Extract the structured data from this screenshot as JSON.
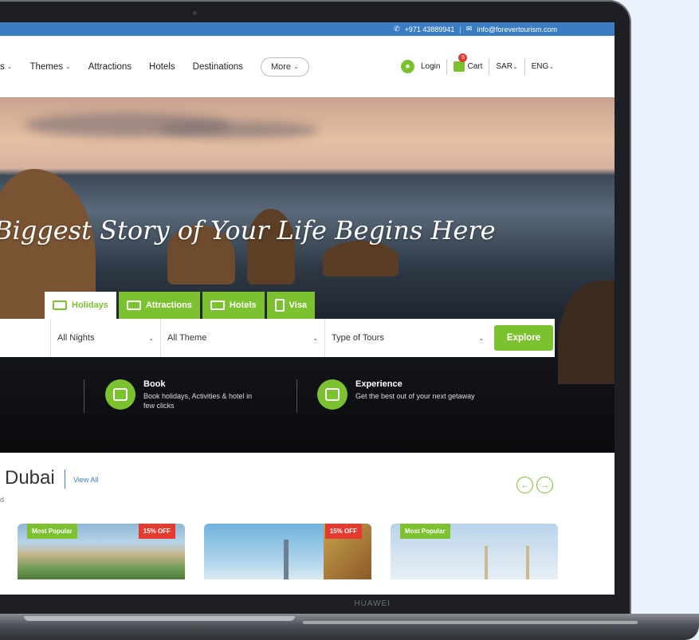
{
  "topbar": {
    "phone": "+971 43889941",
    "separator": "|",
    "email": "info@forevertourism.com"
  },
  "nav": {
    "items": [
      {
        "label": "s"
      },
      {
        "label": "Themes"
      },
      {
        "label": "Attractions"
      },
      {
        "label": "Hotels"
      },
      {
        "label": "Destinations"
      }
    ],
    "more": "More",
    "login": "Login",
    "cart": "Cart",
    "cart_count": "5",
    "currency": "SAR",
    "language": "ENG"
  },
  "hero": {
    "headline": "Biggest Story of Your Life Begins Here",
    "tabs": [
      "Holidays",
      "Attractions",
      "Hotels",
      "Visa"
    ],
    "search": {
      "nights": "All Nights",
      "theme": "All Theme",
      "tour_type": "Type of Tours",
      "explore": "Explore"
    },
    "features": [
      {
        "title": "Book",
        "desc": "Book holidays, Activities & hotel in few clicks"
      },
      {
        "title": "Experience",
        "desc": "Get the best out of your next getaway"
      }
    ]
  },
  "section": {
    "title": "Dubai",
    "view_all": "View All",
    "sub": "d",
    "prev_arrow": "←",
    "next_arrow": "→"
  },
  "cards": [
    {
      "badge": "Most Popular",
      "discount": "15% OFF"
    },
    {
      "badge": "",
      "discount": "15% OFF"
    },
    {
      "badge": "Most Popular",
      "discount": ""
    }
  ],
  "device": {
    "brand": "HUAWEI"
  },
  "colors": {
    "accent": "#7cc12f",
    "topbar": "#3a7dc2",
    "discount": "#e53b2f"
  }
}
